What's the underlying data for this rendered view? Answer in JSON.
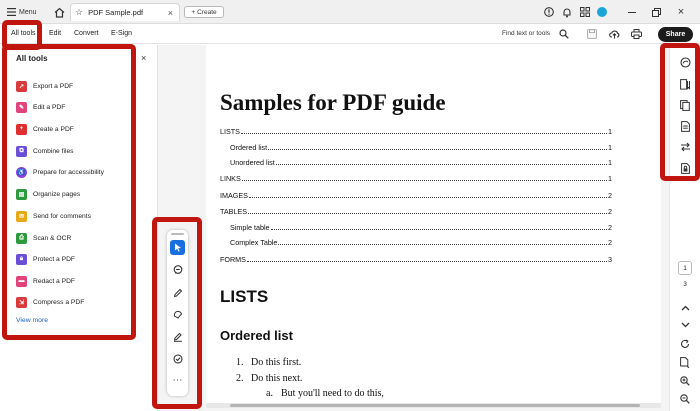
{
  "titlebar": {
    "menu_label": "Menu",
    "tab_title": "PDF Sample.pdf",
    "create_label": "Create",
    "avatar_color": "#1aa6d9"
  },
  "toolbar": {
    "tabs": [
      "All tools",
      "Edit",
      "Convert",
      "E-Sign"
    ],
    "find_label": "Find text or tools",
    "share_label": "Share"
  },
  "panel": {
    "title": "All tools",
    "items": [
      {
        "label": "Export a PDF",
        "color": "#d83b3b"
      },
      {
        "label": "Edit a PDF",
        "color": "#e0447a"
      },
      {
        "label": "Create a PDF",
        "color": "#e02f2f"
      },
      {
        "label": "Combine files",
        "color": "#6a4fd6"
      },
      {
        "label": "Prepare for accessibility",
        "color": "#8b41d6"
      },
      {
        "label": "Organize pages",
        "color": "#2d9a3e"
      },
      {
        "label": "Send for comments",
        "color": "#e8a917"
      },
      {
        "label": "Scan & OCR",
        "color": "#2d9a3e"
      },
      {
        "label": "Protect a PDF",
        "color": "#6a4fd6"
      },
      {
        "label": "Redact a PDF",
        "color": "#e0447a"
      },
      {
        "label": "Compress a PDF",
        "color": "#d83b3b"
      }
    ],
    "view_more": "View more"
  },
  "document": {
    "title": "Samples for PDF guide",
    "toc": [
      {
        "label": "LISTS",
        "page": "1",
        "indent": false
      },
      {
        "label": "Ordered list",
        "page": "1",
        "indent": true
      },
      {
        "label": "Unordered list",
        "page": "1",
        "indent": true
      },
      {
        "label": "LINKS",
        "page": "1",
        "indent": false
      },
      {
        "label": "IMAGES",
        "page": "2",
        "indent": false
      },
      {
        "label": "TABLES",
        "page": "2",
        "indent": false
      },
      {
        "label": "Simple table",
        "page": "2",
        "indent": true
      },
      {
        "label": "Complex Table",
        "page": "2",
        "indent": true
      },
      {
        "label": "FORMS",
        "page": "3",
        "indent": false
      }
    ],
    "heading1": "LISTS",
    "heading2": "Ordered list",
    "list": [
      {
        "marker": "1.",
        "text": "Do this first."
      },
      {
        "marker": "2.",
        "text": "Do this next."
      },
      {
        "marker": "a.",
        "text": "But you'll need to do this,"
      }
    ]
  },
  "navigation": {
    "current_page": "1",
    "total_pages": "3"
  },
  "highlight_color": "#c0160f"
}
